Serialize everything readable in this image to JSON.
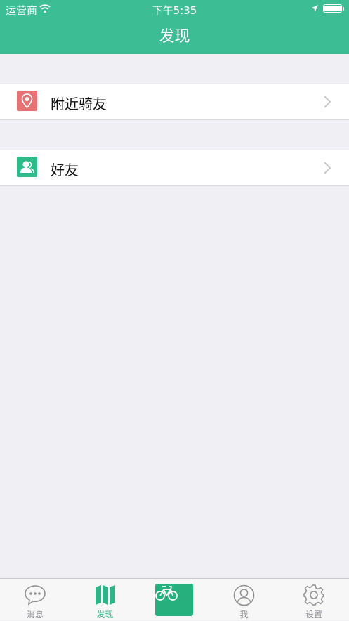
{
  "status_bar": {
    "carrier": "运营商",
    "time": "下午5:35"
  },
  "nav": {
    "title": "发现"
  },
  "list": {
    "items": [
      {
        "label": "附近骑友",
        "icon": "location-pin-icon",
        "color": "#e57373"
      },
      {
        "label": "好友",
        "icon": "friends-icon",
        "color": "#2fba8a"
      }
    ]
  },
  "tabbar": {
    "tabs": [
      {
        "label": "消息",
        "icon": "chat-bubble-icon"
      },
      {
        "label": "发现",
        "icon": "map-icon",
        "active": true
      },
      {
        "label": "",
        "icon": "bicycle-icon"
      },
      {
        "label": "我",
        "icon": "user-icon"
      },
      {
        "label": "设置",
        "icon": "gear-icon"
      }
    ]
  },
  "colors": {
    "accent": "#3dbd93",
    "background": "#efeff4",
    "active_tab": "#2fb487"
  }
}
